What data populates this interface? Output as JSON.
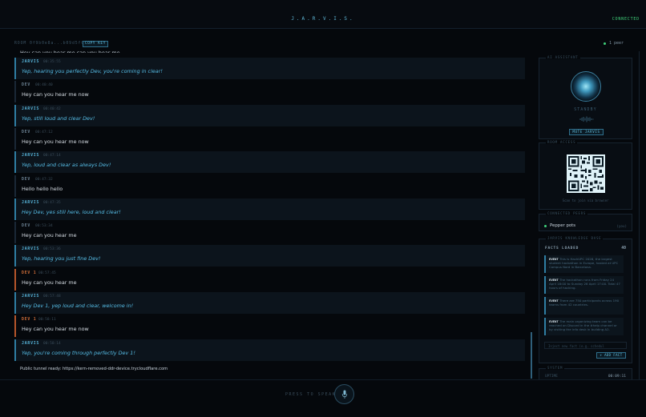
{
  "header": {
    "title": "J.A.R.V.I.S.",
    "status": "CONNECTED"
  },
  "room": {
    "label": "ROOM 0f9b0e8a...b09d5f0f",
    "copy_label": "COPY KEY",
    "peers": "1 peer"
  },
  "chat": {
    "partial_text": "Hey can you hear me can you hear me",
    "messages": [
      {
        "sender": "JARVIS",
        "time": "00:35:55",
        "text": "Yep, hearing you perfectly Dev, you're coming in clear!",
        "kind": "jarvis"
      },
      {
        "sender": "DEV",
        "time": "00:40:40",
        "text": "Hey can you hear me now",
        "kind": "dev"
      },
      {
        "sender": "JARVIS",
        "time": "00:40:42",
        "text": "Yep, still loud and clear Dev!",
        "kind": "jarvis"
      },
      {
        "sender": "DEV",
        "time": "00:47:12",
        "text": "Hey can you hear me now",
        "kind": "dev"
      },
      {
        "sender": "JARVIS",
        "time": "00:47:14",
        "text": "Yep, loud and clear as always Dev!",
        "kind": "jarvis"
      },
      {
        "sender": "DEV",
        "time": "00:47:32",
        "text": "Hello hello hello",
        "kind": "dev"
      },
      {
        "sender": "JARVIS",
        "time": "00:47:35",
        "text": "Hey Dev, yes still here, loud and clear!",
        "kind": "jarvis"
      },
      {
        "sender": "DEV",
        "time": "00:53:34",
        "text": "Hey can you hear me",
        "kind": "dev"
      },
      {
        "sender": "JARVIS",
        "time": "00:53:36",
        "text": "Yep, hearing you just fine Dev!",
        "kind": "jarvis"
      },
      {
        "sender": "DEV 1",
        "time": "00:57:45",
        "text": "Hey can you hear me",
        "kind": "dev1"
      },
      {
        "sender": "JARVIS",
        "time": "00:57:48",
        "text": "Hey Dev 1, yep loud and clear, welcome in!",
        "kind": "jarvis"
      },
      {
        "sender": "DEV 1",
        "time": "00:58:11",
        "text": "Hey can you hear me now",
        "kind": "dev1"
      },
      {
        "sender": "JARVIS",
        "time": "00:58:14",
        "text": "Yep, you're coming through perfectly Dev 1!",
        "kind": "jarvis"
      }
    ],
    "tunnel_note": "Public tunnel ready: https://kern-removed-ddr-device.trycloudflare.com"
  },
  "assistant_panel": {
    "title": "AI ASSISTANT",
    "state": "STANDBY",
    "mute_label": "MUTE JARVIS"
  },
  "room_access": {
    "title": "ROOM ACCESS",
    "caption": "Scan to join via browser"
  },
  "peers_panel": {
    "title": "CONNECTED PEERS",
    "peer_name": "Pepper pots",
    "peer_tag": "(you)"
  },
  "knowledge": {
    "title": "JARVIS KNOWLEDGE BASE",
    "facts_label": "FACTS LOADED",
    "facts_count": "40",
    "facts": [
      {
        "tag": "EVENT",
        "text": "This is HackUPC 2026, the largest student hackathon in Europe, hosted at UPC Campus Nord in Barcelona."
      },
      {
        "tag": "EVENT",
        "text": "The hackathon runs from Friday 24 April 18:00 to Sunday 26 April 17:00. Total 47 hours of hacking."
      },
      {
        "tag": "EVENT",
        "text": "There are 750 participants across 190 teams from 42 countries."
      },
      {
        "tag": "EVENT",
        "text": "The main organizing team can be reached on Discord in the #help channel or by visiting the info desk in building A2."
      }
    ],
    "input_placeholder": "Inject new fact (e.g. schedul",
    "add_label": "+ ADD FACT"
  },
  "system_panel": {
    "title": "SYSTEM",
    "uptime_label": "UPTIME",
    "uptime_value": "00:09:11"
  },
  "footer": {
    "press_label": "PRESS TO SPEAK"
  },
  "colors": {
    "accent": "#58b7dd",
    "online": "#3fd07a",
    "dev1": "#d5703a",
    "background": "#05080c"
  }
}
